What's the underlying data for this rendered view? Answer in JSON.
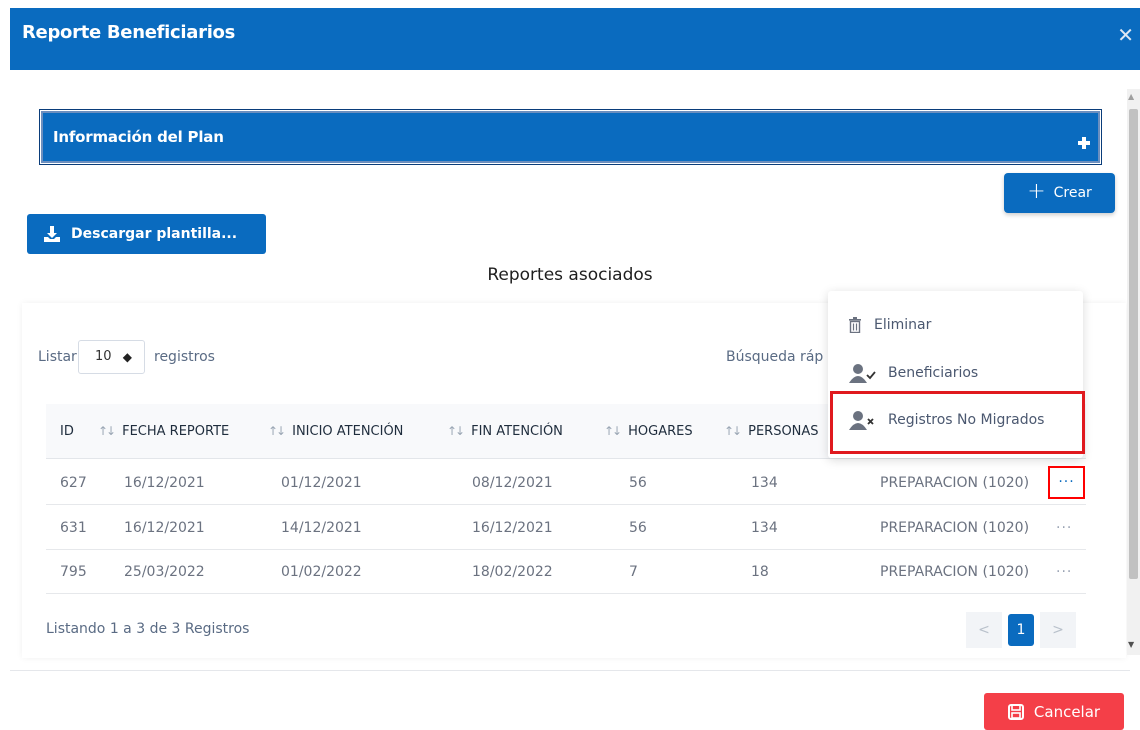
{
  "modal": {
    "title": "Reporte Beneficiarios",
    "close_glyph": "✕"
  },
  "accordion": {
    "title": "Información del Plan",
    "icon": "plus-icon"
  },
  "buttons": {
    "crear_label": "Crear",
    "descargar_label": "Descargar plantilla...",
    "cancelar_label": "Cancelar"
  },
  "section": {
    "title": "Reportes asociados"
  },
  "table_controls": {
    "listar_label": "Listar",
    "page_size": "10",
    "registros_label": "registros",
    "busqueda_label": "Búsqueda ráp"
  },
  "table": {
    "headers": [
      "ID",
      "FECHA REPORTE",
      "INICIO ATENCIÓN",
      "FIN ATENCIÓN",
      "HOGARES",
      "PERSONAS"
    ],
    "rows": [
      {
        "id": "627",
        "fecha": "16/12/2021",
        "inicio": "01/12/2021",
        "fin": "08/12/2021",
        "hogares": "56",
        "personas": "134",
        "estado": "PREPARACION (1020)",
        "actions": "···"
      },
      {
        "id": "631",
        "fecha": "16/12/2021",
        "inicio": "14/12/2021",
        "fin": "16/12/2021",
        "hogares": "56",
        "personas": "134",
        "estado": "PREPARACION (1020)",
        "actions": "···"
      },
      {
        "id": "795",
        "fecha": "25/03/2022",
        "inicio": "01/02/2022",
        "fin": "18/02/2022",
        "hogares": "7",
        "personas": "18",
        "estado": "PREPARACION (1020)",
        "actions": "···"
      }
    ],
    "footer_info": "Listando 1 a 3 de 3 Registros",
    "pagination": {
      "prev": "<",
      "current": "1",
      "next": ">"
    }
  },
  "dropdown_menu": {
    "items": [
      {
        "label": "Eliminar",
        "icon": "trash-icon"
      },
      {
        "label": "Beneficiarios",
        "icon": "user-check-icon"
      },
      {
        "label": "Registros No Migrados",
        "icon": "user-x-icon"
      }
    ]
  },
  "colors": {
    "primary": "#0a6bbf",
    "danger": "#f43f48",
    "highlight": "#e0191e"
  }
}
